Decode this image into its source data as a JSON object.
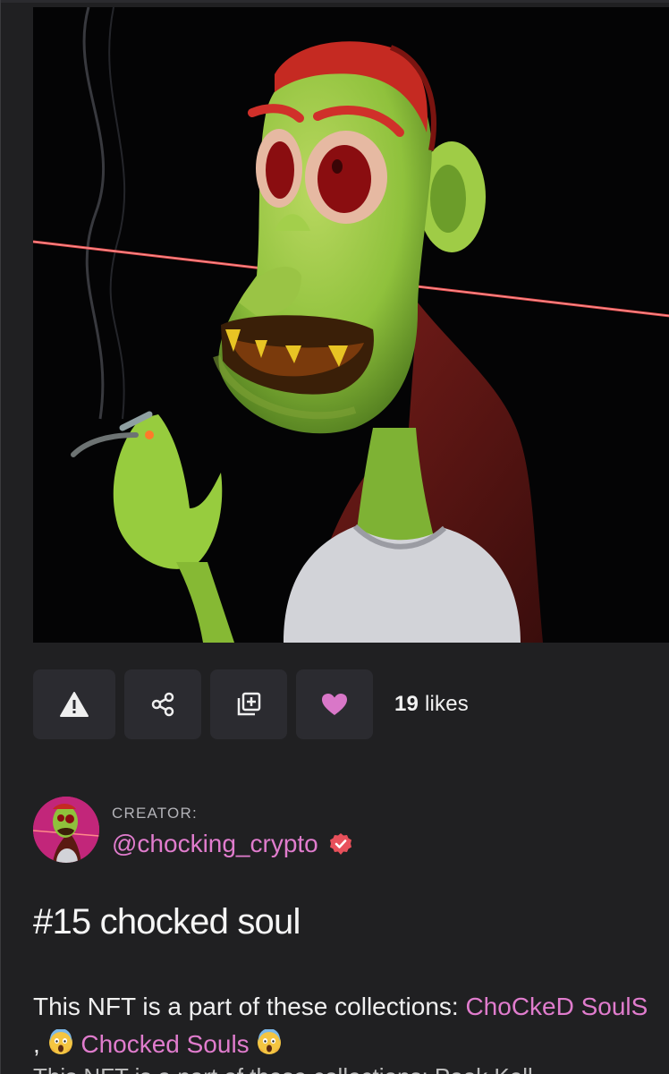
{
  "artwork": {
    "icon": "artwork-image"
  },
  "actions": {
    "report_icon": "warning-icon",
    "share_icon": "share-icon",
    "add_icon": "add-to-collection-icon",
    "like_icon": "heart-icon",
    "likes_count": "19",
    "likes_label": " likes"
  },
  "creator": {
    "label": "CREATOR:",
    "handle": "@chocking_crypto",
    "verified_icon": "verified-badge-icon"
  },
  "nft": {
    "title": "#15 chocked soul"
  },
  "collections": {
    "intro": "This NFT is a part of these collections: ",
    "first": "ChoCkeD SoulS",
    "separator": " , ",
    "second": "Chocked Souls",
    "partial_next_line": "This NFT is a part of these collections: Pook Kell"
  },
  "colors": {
    "background": "#202022",
    "accent_pink": "#e07ccd",
    "button_bg": "#2b2b30",
    "verified": "#e8505b"
  }
}
